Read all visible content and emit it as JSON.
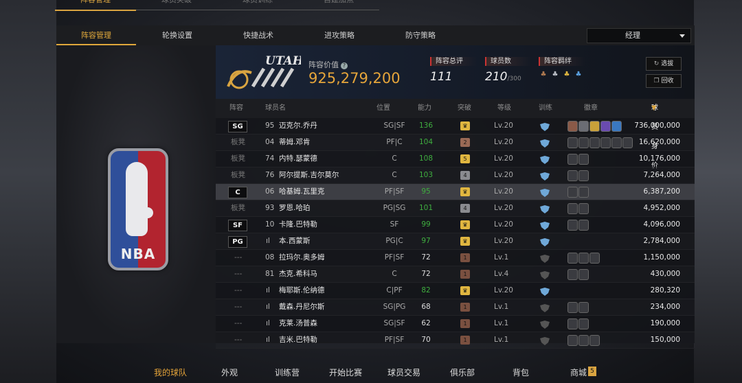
{
  "top_tabs": [
    "阵容管理",
    "球员突破",
    "球员训练",
    "自建加点"
  ],
  "sub_tabs": [
    "阵容管理",
    "轮换设置",
    "快捷战术",
    "进攻策略",
    "防守策略"
  ],
  "dropdown": {
    "value": "经理"
  },
  "team": {
    "logo_text": "UTAH JAZZ",
    "value_label": "阵容价值",
    "value": "925,279,200",
    "overall_label": "阵容总评",
    "overall": "111",
    "players_label": "球员数",
    "players": "210",
    "players_max": "/300",
    "bonds_label": "阵容羁绊",
    "btn_select": "选拔",
    "btn_recycle": "回收"
  },
  "league_logo_text": "NBA",
  "columns": {
    "pos": "阵容",
    "name": "球员名",
    "position": "位置",
    "rating": "能力",
    "breakthrough": "突破",
    "level": "等级",
    "training": "训练",
    "badges": "徽章",
    "price": "球员身价"
  },
  "rows": [
    {
      "pos": "SG",
      "num": "95",
      "name": "迈克尔.乔丹",
      "position": "SG|SF",
      "rating": "136",
      "rating_green": true,
      "brk": "crown",
      "level": "Lv.20",
      "price": "736,000,000"
    },
    {
      "pos": "板凳",
      "num": "04",
      "name": "蒂姆.邓肯",
      "position": "PF|C",
      "rating": "104",
      "rating_green": true,
      "brk": "2",
      "level": "Lv.20",
      "price": "16,620,000"
    },
    {
      "pos": "板凳",
      "num": "74",
      "name": "内特.瑟蒙德",
      "position": "C",
      "rating": "108",
      "rating_green": true,
      "brk": "5",
      "level": "Lv.20",
      "price": "10,176,000"
    },
    {
      "pos": "板凳",
      "num": "76",
      "name": "阿尔提斯.吉尔莫尔",
      "position": "C",
      "rating": "103",
      "rating_green": true,
      "brk": "4",
      "level": "Lv.20",
      "price": "7,264,000"
    },
    {
      "pos": "C",
      "num": "06",
      "name": "哈基姆.瓦里克",
      "position": "PF|SF",
      "rating": "95",
      "rating_green": true,
      "brk": "crown",
      "level": "Lv.20",
      "price": "6,387,200"
    },
    {
      "pos": "板凳",
      "num": "93",
      "name": "罗恩.哈珀",
      "position": "PG|SG",
      "rating": "101",
      "rating_green": true,
      "brk": "4",
      "level": "Lv.20",
      "price": "4,952,000"
    },
    {
      "pos": "SF",
      "num": "10",
      "name": "卡隆.巴特勒",
      "position": "SF",
      "rating": "99",
      "rating_green": true,
      "brk": "crown",
      "level": "Lv.20",
      "price": "4,096,000"
    },
    {
      "pos": "PG",
      "num": "",
      "name": "本.西蒙斯",
      "position": "PG|C",
      "rating": "97",
      "rating_green": true,
      "brk": "crown",
      "level": "Lv.20",
      "price": "2,784,000"
    },
    {
      "pos": "---",
      "num": "08",
      "name": "拉玛尔.奥多姆",
      "position": "PF|SF",
      "rating": "72",
      "rating_green": false,
      "brk": "1",
      "level": "Lv.1",
      "price": "1,150,000"
    },
    {
      "pos": "---",
      "num": "81",
      "name": "杰克.希科马",
      "position": "C",
      "rating": "72",
      "rating_green": false,
      "brk": "1",
      "level": "Lv.4",
      "price": "430,000"
    },
    {
      "pos": "---",
      "num": "",
      "name": "梅耶斯.伦纳德",
      "position": "C|PF",
      "rating": "82",
      "rating_green": true,
      "brk": "crown",
      "level": "Lv.20",
      "price": "280,320"
    },
    {
      "pos": "---",
      "num": "",
      "name": "戴森.丹尼尔斯",
      "position": "SG|PG",
      "rating": "68",
      "rating_green": false,
      "brk": "1",
      "level": "Lv.1",
      "price": "234,000"
    },
    {
      "pos": "---",
      "num": "",
      "name": "克莱.汤普森",
      "position": "SG|SF",
      "rating": "62",
      "rating_green": false,
      "brk": "1",
      "level": "Lv.1",
      "price": "190,000"
    },
    {
      "pos": "---",
      "num": "",
      "name": "吉米.巴特勒",
      "position": "PF|SF",
      "rating": "70",
      "rating_green": false,
      "brk": "1",
      "level": "Lv.1",
      "price": "150,000"
    }
  ],
  "bottom_nav": [
    "我的球队",
    "外观",
    "训练营",
    "开始比赛",
    "球员交易",
    "俱乐部",
    "背包",
    "商城"
  ],
  "colors": {
    "accent": "#e0a83b",
    "green": "#3fae3f"
  }
}
